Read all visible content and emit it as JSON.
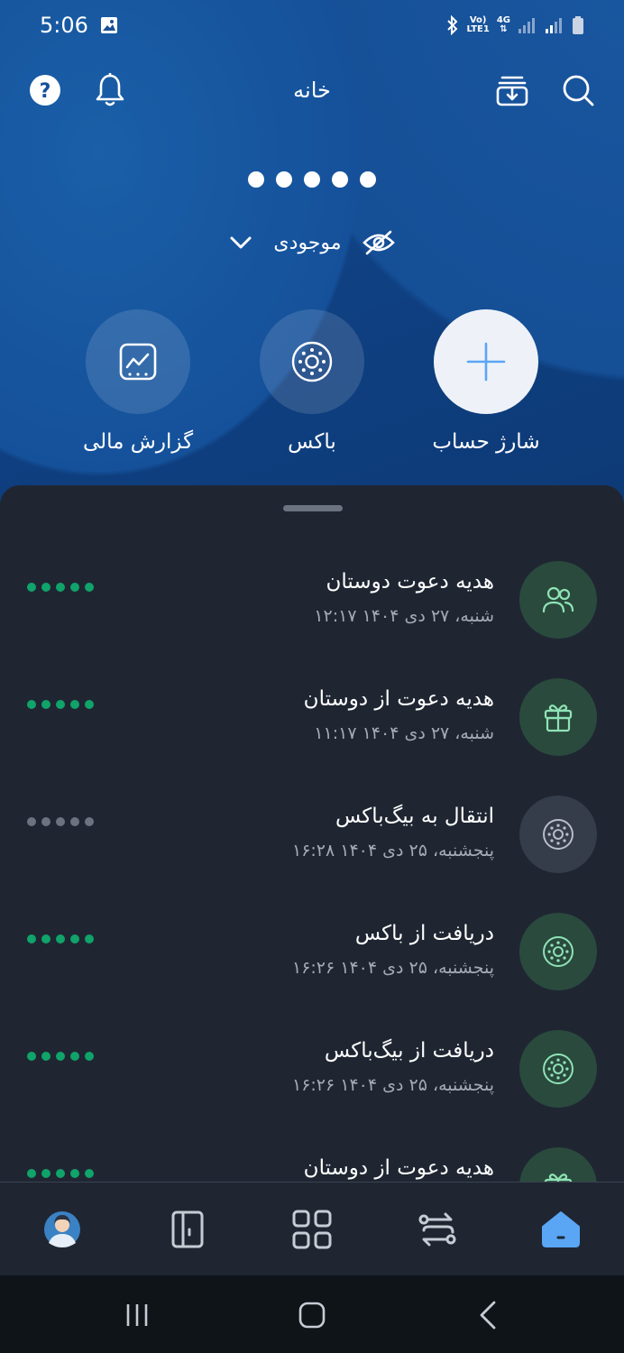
{
  "status_bar": {
    "time": "5:06",
    "volte": "Vo)",
    "lte": "LTE1",
    "network": "4G"
  },
  "header": {
    "title": "خانه"
  },
  "balance": {
    "masked_dots": 5,
    "label": "موجودی"
  },
  "actions": [
    {
      "label": "شارژ حساب",
      "icon": "plus-icon"
    },
    {
      "label": "باکس",
      "icon": "box-icon"
    },
    {
      "label": "گزارش مالی",
      "icon": "chart-icon"
    }
  ],
  "transactions": [
    {
      "title": "هدیه دعوت دوستان",
      "date": "شنبه، ۲۷ دی ۱۴۰۴ ۱۲:۱۷",
      "icon": "users-icon",
      "status": "green"
    },
    {
      "title": "هدیه دعوت از دوستان",
      "date": "شنبه، ۲۷ دی ۱۴۰۴ ۱۱:۱۷",
      "icon": "gift-icon",
      "status": "green"
    },
    {
      "title": "انتقال به بیگ‌باکس",
      "date": "پنجشنبه، ۲۵ دی ۱۴۰۴ ۱۶:۲۸",
      "icon": "box-icon",
      "status": "gray"
    },
    {
      "title": "دریافت از باکس",
      "date": "پنجشنبه، ۲۵ دی ۱۴۰۴ ۱۶:۲۶",
      "icon": "box-icon",
      "status": "green"
    },
    {
      "title": "دریافت از بیگ‌باکس",
      "date": "پنجشنبه، ۲۵ دی ۱۴۰۴ ۱۶:۲۶",
      "icon": "box-icon",
      "status": "green"
    },
    {
      "title": "هدیه دعوت از دوستان",
      "date": "",
      "icon": "gift-icon",
      "status": "green"
    }
  ],
  "colors": {
    "accent": "#1b4fa0",
    "green": "#10a36a",
    "sheet": "#1f2632",
    "nav_active": "#5aa6f5"
  },
  "bottom_nav": [
    "profile",
    "wallet",
    "apps",
    "transfer",
    "home"
  ]
}
